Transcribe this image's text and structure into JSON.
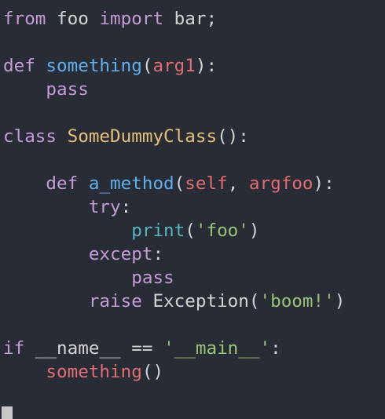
{
  "colors": {
    "background": "#282c34",
    "keyword": "#c59bd8",
    "function": "#61afef",
    "parameter": "#e06c75",
    "class": "#e5c07b",
    "builtin": "#56b6c2",
    "string": "#98c379",
    "text": "#d4d4d4",
    "cursor": "#c8c8c8"
  },
  "lines": [
    [
      [
        "kw",
        "from"
      ],
      [
        "plain",
        " foo "
      ],
      [
        "kw",
        "import"
      ],
      [
        "plain",
        " bar;"
      ]
    ],
    [],
    [
      [
        "kw",
        "def"
      ],
      [
        "plain",
        " "
      ],
      [
        "fn",
        "something"
      ],
      [
        "plain",
        "("
      ],
      [
        "param",
        "arg1"
      ],
      [
        "plain",
        "):"
      ]
    ],
    [
      [
        "plain",
        "    "
      ],
      [
        "kw",
        "pass"
      ]
    ],
    [],
    [
      [
        "kw",
        "class"
      ],
      [
        "plain",
        " "
      ],
      [
        "cls",
        "SomeDummyClass"
      ],
      [
        "plain",
        "():"
      ]
    ],
    [],
    [
      [
        "plain",
        "    "
      ],
      [
        "kw",
        "def"
      ],
      [
        "plain",
        " "
      ],
      [
        "fn",
        "a_method"
      ],
      [
        "plain",
        "("
      ],
      [
        "param",
        "self"
      ],
      [
        "plain",
        ", "
      ],
      [
        "param",
        "argfoo"
      ],
      [
        "plain",
        "):"
      ]
    ],
    [
      [
        "plain",
        "        "
      ],
      [
        "kw",
        "try"
      ],
      [
        "plain",
        ":"
      ]
    ],
    [
      [
        "plain",
        "            "
      ],
      [
        "builtin",
        "print"
      ],
      [
        "plain",
        "("
      ],
      [
        "str",
        "'foo'"
      ],
      [
        "plain",
        ")"
      ]
    ],
    [
      [
        "plain",
        "        "
      ],
      [
        "kw",
        "except"
      ],
      [
        "plain",
        ":"
      ]
    ],
    [
      [
        "plain",
        "            "
      ],
      [
        "kw",
        "pass"
      ]
    ],
    [
      [
        "plain",
        "        "
      ],
      [
        "kw",
        "raise"
      ],
      [
        "plain",
        " Exception("
      ],
      [
        "str",
        "'boom!'"
      ],
      [
        "plain",
        ")"
      ]
    ],
    [],
    [
      [
        "kw",
        "if"
      ],
      [
        "plain",
        " __name__ == "
      ],
      [
        "str",
        "'__main__'"
      ],
      [
        "plain",
        ":"
      ]
    ],
    [
      [
        "plain",
        "    "
      ],
      [
        "param",
        "something"
      ],
      [
        "plain",
        "()"
      ]
    ]
  ]
}
